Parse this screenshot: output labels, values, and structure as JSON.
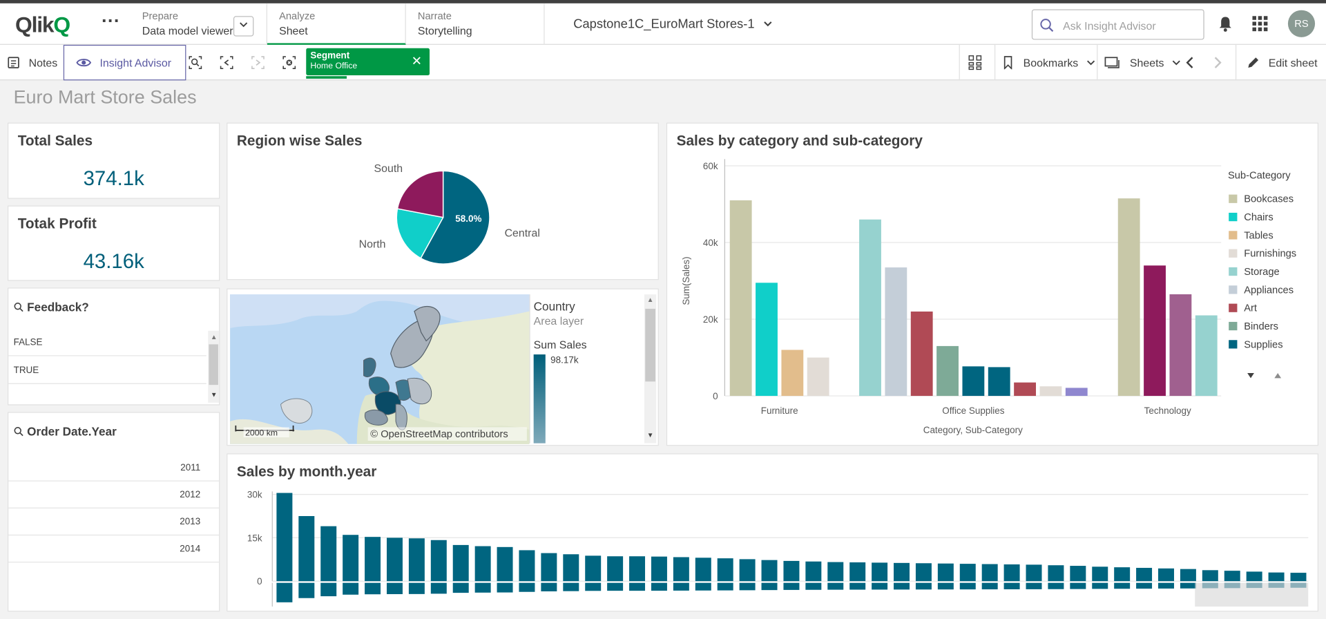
{
  "header": {
    "logo": "Qlik",
    "menu_dots": "···",
    "tabs": [
      {
        "small": "Prepare",
        "big": "Data model viewer"
      },
      {
        "small": "Analyze",
        "big": "Sheet"
      },
      {
        "small": "Narrate",
        "big": "Storytelling"
      }
    ],
    "app_title": "Capstone1C_EuroMart Stores-1",
    "search_placeholder": "Ask Insight Advisor",
    "avatar": "RS"
  },
  "toolbar": {
    "notes": "Notes",
    "insight_advisor": "Insight Advisor",
    "selection": {
      "field": "Segment",
      "value": "Home Office"
    },
    "bookmarks": "Bookmarks",
    "sheets": "Sheets",
    "edit_sheet": "Edit sheet"
  },
  "sheet_title": "Euro Mart Store Sales",
  "kpis": [
    {
      "title": "Total Sales",
      "value": "374.1k"
    },
    {
      "title": "Totak Profit",
      "value": "43.16k"
    }
  ],
  "feedback": {
    "title": "Feedback?",
    "items": [
      "FALSE",
      "TRUE"
    ]
  },
  "order_year": {
    "title": "Order Date.Year",
    "items": [
      "2011",
      "2012",
      "2013",
      "2014"
    ]
  },
  "colors": {
    "accent": "#005f7a",
    "selection": "#009845",
    "insight": "#6665a8"
  },
  "region_chart": {
    "title": "Region wise Sales",
    "chart_data": {
      "type": "pie",
      "labels": [
        "Central",
        "North",
        "South"
      ],
      "values": [
        58.0,
        20.0,
        22.0
      ],
      "colors": [
        "#006580",
        "#10cfc9",
        "#8e1a5c"
      ],
      "data_label": "58.0%"
    }
  },
  "map": {
    "legend_title": "Country",
    "legend_sub": "Area layer",
    "measure": "Sum Sales",
    "max_value": "98.17k",
    "scale": "2000 km",
    "attribution": "© OpenStreetMap contributors"
  },
  "category_chart": {
    "title": "Sales by category and sub-category",
    "ylabel": "Sum(Sales)",
    "xlabel": "Category, Sub-Category",
    "legend_title": "Sub-Category",
    "yticks": [
      "60k",
      "40k",
      "20k",
      "0"
    ],
    "chart_data": {
      "type": "bar",
      "ylim": [
        0,
        60000
      ],
      "categories": [
        "Furniture",
        "Office Supplies",
        "Technology"
      ],
      "legend": [
        {
          "name": "Bookcases",
          "color": "#c8c8a8"
        },
        {
          "name": "Chairs",
          "color": "#10cfc9"
        },
        {
          "name": "Tables",
          "color": "#e2bd8c"
        },
        {
          "name": "Furnishings",
          "color": "#e2dcd6"
        },
        {
          "name": "Storage",
          "color": "#96d2cf"
        },
        {
          "name": "Appliances",
          "color": "#c4ced8"
        },
        {
          "name": "Art",
          "color": "#b04a55"
        },
        {
          "name": "Binders",
          "color": "#7eaa97"
        },
        {
          "name": "Supplies",
          "color": "#006580"
        }
      ],
      "bars": [
        {
          "category": "Furniture",
          "sub": "Bookcases",
          "value": 51000,
          "color": "#c8c8a8"
        },
        {
          "category": "Furniture",
          "sub": "Chairs",
          "value": 29500,
          "color": "#10cfc9"
        },
        {
          "category": "Furniture",
          "sub": "Tables",
          "value": 12000,
          "color": "#e2bd8c"
        },
        {
          "category": "Furniture",
          "sub": "Furnishings",
          "value": 10000,
          "color": "#e2dcd6"
        },
        {
          "category": "Office Supplies",
          "sub": "Storage",
          "value": 46000,
          "color": "#96d2cf"
        },
        {
          "category": "Office Supplies",
          "sub": "Appliances",
          "value": 33500,
          "color": "#c4ced8"
        },
        {
          "category": "Office Supplies",
          "sub": "Art",
          "value": 22000,
          "color": "#b04a55"
        },
        {
          "category": "Office Supplies",
          "sub": "Binders",
          "value": 13000,
          "color": "#7eaa97"
        },
        {
          "category": "Office Supplies",
          "sub": "Supplies",
          "value": 7700,
          "color": "#006580"
        },
        {
          "category": "Office Supplies",
          "sub": "",
          "value": 7500,
          "color": "#006580"
        },
        {
          "category": "Office Supplies",
          "sub": "",
          "value": 3500,
          "color": "#b04a55"
        },
        {
          "category": "Office Supplies",
          "sub": "",
          "value": 2500,
          "color": "#e2dcd6"
        },
        {
          "category": "Office Supplies",
          "sub": "",
          "value": 2100,
          "color": "#8f87cf"
        },
        {
          "category": "Technology",
          "sub": "",
          "value": 51500,
          "color": "#c8c8a8"
        },
        {
          "category": "Technology",
          "sub": "",
          "value": 34000,
          "color": "#8e1a5c"
        },
        {
          "category": "Technology",
          "sub": "",
          "value": 26500,
          "color": "#a0608f"
        },
        {
          "category": "Technology",
          "sub": "",
          "value": 21000,
          "color": "#96d2cf"
        }
      ]
    }
  },
  "month_chart": {
    "title": "Sales by month.year",
    "yticks": [
      "30k",
      "15k",
      "0"
    ],
    "chart_data": {
      "type": "bar",
      "ylim": [
        0,
        31000
      ],
      "color": "#006580",
      "values": [
        30500,
        22500,
        19000,
        16000,
        15300,
        15000,
        14800,
        14200,
        12500,
        12100,
        11800,
        10700,
        9700,
        9300,
        8800,
        8600,
        8600,
        8500,
        8300,
        8100,
        7900,
        7600,
        7300,
        7000,
        6800,
        6600,
        6500,
        6400,
        6300,
        6200,
        6100,
        6000,
        5900,
        5800,
        5700,
        5500,
        5300,
        5000,
        4800,
        4600,
        4400,
        4200,
        3800,
        3600,
        3300,
        3000,
        2900
      ],
      "overview_values": [
        30500,
        22500,
        19000,
        16000,
        15300,
        15000,
        14800,
        14200,
        12500,
        12100,
        11800,
        10700,
        9700,
        9300,
        8800,
        8600,
        8600,
        8500,
        8300,
        8100,
        7900,
        7600,
        7300,
        7000,
        6800,
        6600,
        6500,
        6400,
        6300,
        6200,
        6100,
        6000,
        5900,
        5800,
        5700,
        5500,
        5300,
        5000,
        4800,
        4600,
        4400,
        4200,
        3800,
        3600,
        3300,
        3000,
        2900
      ]
    }
  }
}
